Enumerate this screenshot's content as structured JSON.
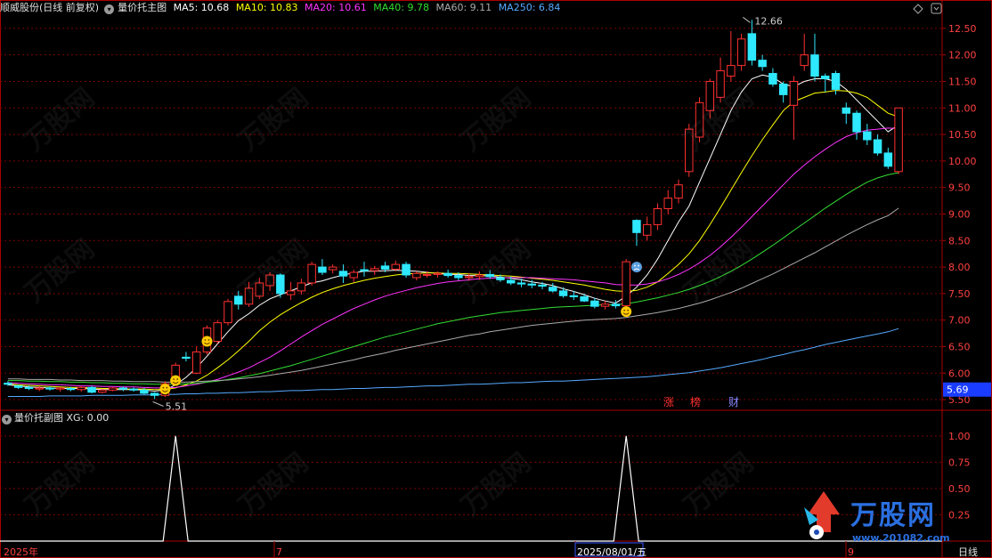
{
  "header": {
    "stock": "顺威股份(日线 前复权)",
    "indicator": "量价托主图",
    "ma": [
      {
        "label": "MA5: 10.68",
        "color": "#ffffff"
      },
      {
        "label": "MA10: 10.83",
        "color": "#ffff00"
      },
      {
        "label": "MA20: 10.61",
        "color": "#ff33ff"
      },
      {
        "label": "MA40: 9.78",
        "color": "#33dd33"
      },
      {
        "label": "MA60: 9.11",
        "color": "#aaaaaa"
      },
      {
        "label": "MA250: 6.84",
        "color": "#55aaff"
      }
    ]
  },
  "sub_header": {
    "title": "量价托副图",
    "xg": "XG: 0.00"
  },
  "colors": {
    "up": "#ff3030",
    "down": "#2ee8ff",
    "grid": "#7a0000",
    "axis": "#aa0000",
    "last_price_bg": "#1a3cff"
  },
  "price_axis": {
    "ticks": [
      "12.50",
      "12.00",
      "11.50",
      "11.00",
      "10.50",
      "10.00",
      "9.50",
      "9.00",
      "8.50",
      "8.00",
      "7.50",
      "7.00",
      "6.50",
      "6.00",
      "5.50"
    ]
  },
  "last_price": "5.69",
  "high_label": "12.66",
  "low_label": "5.51",
  "sub_axis": {
    "ticks": [
      "1.00",
      "0.75",
      "0.50",
      "0.25"
    ]
  },
  "badges": [
    "涨",
    "榜",
    "财"
  ],
  "date_axis": {
    "labels": [
      "2025年",
      "7",
      "2025/08/01/五",
      "9"
    ],
    "period": "日线"
  },
  "watermark": {
    "text": "万股网",
    "url": "www.201082.com"
  },
  "logo": {
    "text": "万股网",
    "url": "www.201082.com"
  },
  "chart_data": {
    "type": "candlestick",
    "candles": [
      [
        5.81,
        5.85,
        5.76,
        5.79
      ],
      [
        5.76,
        5.78,
        5.7,
        5.73
      ],
      [
        5.73,
        5.77,
        5.68,
        5.71
      ],
      [
        5.7,
        5.75,
        5.66,
        5.72
      ],
      [
        5.72,
        5.75,
        5.67,
        5.7
      ],
      [
        5.7,
        5.73,
        5.65,
        5.72
      ],
      [
        5.71,
        5.74,
        5.66,
        5.69
      ],
      [
        5.69,
        5.76,
        5.65,
        5.73
      ],
      [
        5.73,
        5.76,
        5.62,
        5.64
      ],
      [
        5.64,
        5.7,
        5.62,
        5.68
      ],
      [
        5.68,
        5.74,
        5.66,
        5.72
      ],
      [
        5.72,
        5.75,
        5.66,
        5.7
      ],
      [
        5.7,
        5.73,
        5.65,
        5.68
      ],
      [
        5.68,
        5.72,
        5.6,
        5.62
      ],
      [
        5.62,
        5.64,
        5.51,
        5.58
      ],
      [
        5.58,
        5.85,
        5.55,
        5.8
      ],
      [
        5.8,
        6.2,
        5.78,
        6.15
      ],
      [
        6.3,
        6.4,
        6.22,
        6.28
      ],
      [
        6.0,
        6.5,
        5.98,
        6.4
      ],
      [
        6.4,
        6.9,
        6.35,
        6.85
      ],
      [
        6.6,
        7.0,
        6.55,
        6.95
      ],
      [
        6.95,
        7.4,
        6.9,
        7.35
      ],
      [
        7.45,
        7.55,
        7.2,
        7.3
      ],
      [
        7.3,
        7.72,
        7.25,
        7.6
      ],
      [
        7.45,
        7.8,
        7.4,
        7.7
      ],
      [
        7.65,
        7.9,
        7.55,
        7.85
      ],
      [
        7.85,
        7.88,
        7.42,
        7.5
      ],
      [
        7.48,
        7.72,
        7.38,
        7.55
      ],
      [
        7.55,
        7.78,
        7.48,
        7.7
      ],
      [
        7.7,
        8.1,
        7.65,
        8.05
      ],
      [
        8.0,
        8.15,
        7.85,
        7.9
      ],
      [
        7.95,
        8.05,
        7.88,
        8.0
      ],
      [
        7.92,
        8.05,
        7.7,
        7.83
      ],
      [
        7.8,
        7.95,
        7.72,
        7.9
      ],
      [
        7.95,
        8.1,
        7.82,
        7.93
      ],
      [
        7.93,
        8.02,
        7.85,
        7.97
      ],
      [
        8.02,
        8.1,
        7.9,
        7.96
      ],
      [
        7.96,
        8.12,
        7.92,
        8.05
      ],
      [
        8.05,
        8.1,
        7.8,
        7.85
      ],
      [
        7.8,
        7.92,
        7.75,
        7.88
      ],
      [
        7.85,
        7.92,
        7.8,
        7.86
      ],
      [
        7.86,
        7.92,
        7.8,
        7.88
      ],
      [
        7.88,
        7.95,
        7.8,
        7.84
      ],
      [
        7.84,
        7.9,
        7.75,
        7.8
      ],
      [
        7.8,
        7.88,
        7.74,
        7.82
      ],
      [
        7.82,
        7.92,
        7.76,
        7.85
      ],
      [
        7.86,
        7.94,
        7.78,
        7.82
      ],
      [
        7.8,
        7.86,
        7.72,
        7.76
      ],
      [
        7.75,
        7.82,
        7.66,
        7.7
      ],
      [
        7.7,
        7.78,
        7.62,
        7.68
      ],
      [
        7.68,
        7.76,
        7.6,
        7.66
      ],
      [
        7.66,
        7.72,
        7.58,
        7.64
      ],
      [
        7.62,
        7.7,
        7.52,
        7.55
      ],
      [
        7.55,
        7.62,
        7.42,
        7.46
      ],
      [
        7.46,
        7.55,
        7.38,
        7.44
      ],
      [
        7.44,
        7.5,
        7.34,
        7.36
      ],
      [
        7.36,
        7.42,
        7.22,
        7.26
      ],
      [
        7.26,
        7.36,
        7.2,
        7.3
      ],
      [
        7.3,
        7.38,
        7.22,
        7.27
      ],
      [
        7.27,
        8.15,
        7.25,
        8.1
      ],
      [
        8.88,
        8.9,
        8.4,
        8.65
      ],
      [
        8.6,
        8.95,
        8.5,
        8.8
      ],
      [
        8.8,
        9.2,
        8.7,
        9.1
      ],
      [
        9.1,
        9.45,
        9.0,
        9.3
      ],
      [
        9.3,
        9.65,
        9.2,
        9.55
      ],
      [
        9.8,
        10.7,
        9.7,
        10.6
      ],
      [
        10.45,
        11.2,
        10.35,
        11.1
      ],
      [
        10.95,
        11.55,
        10.8,
        11.5
      ],
      [
        11.2,
        11.95,
        11.1,
        11.7
      ],
      [
        11.6,
        12.45,
        11.5,
        11.8
      ],
      [
        11.8,
        12.4,
        11.7,
        12.3
      ],
      [
        12.4,
        12.66,
        11.8,
        11.9
      ],
      [
        11.9,
        12.0,
        11.7,
        11.78
      ],
      [
        11.65,
        11.75,
        11.4,
        11.45
      ],
      [
        11.45,
        11.5,
        11.1,
        11.25
      ],
      [
        11.05,
        11.6,
        10.4,
        11.5
      ],
      [
        11.8,
        12.4,
        11.7,
        12.0
      ],
      [
        12.0,
        12.4,
        11.5,
        11.6
      ],
      [
        11.6,
        11.65,
        11.3,
        11.55
      ],
      [
        11.65,
        11.7,
        11.25,
        11.35
      ],
      [
        11.0,
        11.1,
        10.7,
        10.9
      ],
      [
        10.9,
        10.95,
        10.4,
        10.55
      ],
      [
        10.55,
        10.7,
        10.3,
        10.4
      ],
      [
        10.4,
        10.5,
        10.1,
        10.15
      ],
      [
        10.15,
        10.25,
        9.85,
        9.9
      ],
      [
        9.8,
        11.0,
        9.75,
        11.0
      ]
    ],
    "ma": [
      {
        "name": "MA5",
        "color": "#ffffff",
        "values": [
          5.78,
          5.76,
          5.74,
          5.73,
          5.72,
          5.71,
          5.71,
          5.71,
          5.7,
          5.69,
          5.69,
          5.69,
          5.69,
          5.68,
          5.66,
          5.68,
          5.78,
          5.92,
          6.1,
          6.32,
          6.55,
          6.78,
          6.99,
          7.12,
          7.28,
          7.4,
          7.48,
          7.55,
          7.63,
          7.7,
          7.74,
          7.8,
          7.85,
          7.89,
          7.92,
          7.92,
          7.93,
          7.94,
          7.93,
          7.92,
          7.9,
          7.88,
          7.86,
          7.86,
          7.84,
          7.84,
          7.83,
          7.81,
          7.79,
          7.76,
          7.72,
          7.69,
          7.65,
          7.59,
          7.54,
          7.48,
          7.41,
          7.36,
          7.32,
          7.45,
          7.62,
          7.85,
          8.15,
          8.5,
          8.85,
          9.15,
          9.6,
          10.05,
          10.5,
          10.95,
          11.3,
          11.55,
          11.62,
          11.58,
          11.45,
          11.4,
          11.5,
          11.55,
          11.55,
          11.5,
          11.35,
          11.15,
          10.95,
          10.75,
          10.55,
          10.68
        ]
      },
      {
        "name": "MA10",
        "color": "#ffff00",
        "values": [
          5.8,
          5.78,
          5.77,
          5.76,
          5.75,
          5.74,
          5.73,
          5.73,
          5.72,
          5.71,
          5.71,
          5.7,
          5.7,
          5.7,
          5.69,
          5.69,
          5.72,
          5.78,
          5.85,
          5.96,
          6.1,
          6.25,
          6.42,
          6.6,
          6.8,
          6.96,
          7.1,
          7.22,
          7.33,
          7.43,
          7.52,
          7.59,
          7.65,
          7.7,
          7.75,
          7.79,
          7.82,
          7.85,
          7.87,
          7.88,
          7.89,
          7.89,
          7.88,
          7.88,
          7.87,
          7.86,
          7.85,
          7.84,
          7.83,
          7.81,
          7.79,
          7.77,
          7.75,
          7.72,
          7.69,
          7.66,
          7.62,
          7.58,
          7.55,
          7.54,
          7.56,
          7.62,
          7.72,
          7.88,
          8.05,
          8.25,
          8.5,
          8.8,
          9.12,
          9.45,
          9.78,
          10.1,
          10.4,
          10.68,
          10.95,
          11.12,
          11.2,
          11.28,
          11.3,
          11.33,
          11.32,
          11.28,
          11.2,
          11.05,
          10.9,
          10.83
        ]
      },
      {
        "name": "MA20",
        "color": "#ff33ff",
        "values": [
          5.82,
          5.81,
          5.8,
          5.79,
          5.78,
          5.78,
          5.77,
          5.76,
          5.76,
          5.75,
          5.75,
          5.74,
          5.74,
          5.73,
          5.72,
          5.72,
          5.73,
          5.76,
          5.79,
          5.83,
          5.88,
          5.95,
          6.02,
          6.1,
          6.2,
          6.3,
          6.42,
          6.55,
          6.68,
          6.8,
          6.92,
          7.02,
          7.12,
          7.22,
          7.3,
          7.38,
          7.45,
          7.51,
          7.56,
          7.61,
          7.65,
          7.69,
          7.72,
          7.74,
          7.76,
          7.78,
          7.79,
          7.8,
          7.8,
          7.8,
          7.8,
          7.79,
          7.78,
          7.77,
          7.76,
          7.74,
          7.72,
          7.7,
          7.67,
          7.66,
          7.66,
          7.68,
          7.72,
          7.78,
          7.86,
          7.96,
          8.08,
          8.22,
          8.38,
          8.56,
          8.75,
          8.95,
          9.15,
          9.35,
          9.55,
          9.75,
          9.92,
          10.08,
          10.22,
          10.35,
          10.46,
          10.53,
          10.58,
          10.6,
          10.62,
          10.61
        ]
      },
      {
        "name": "MA40",
        "color": "#33dd33",
        "values": [
          5.86,
          5.86,
          5.85,
          5.85,
          5.84,
          5.84,
          5.83,
          5.83,
          5.82,
          5.82,
          5.81,
          5.81,
          5.8,
          5.8,
          5.79,
          5.79,
          5.79,
          5.8,
          5.81,
          5.83,
          5.85,
          5.88,
          5.91,
          5.95,
          5.99,
          6.04,
          6.09,
          6.14,
          6.2,
          6.26,
          6.32,
          6.38,
          6.44,
          6.5,
          6.56,
          6.62,
          6.68,
          6.73,
          6.78,
          6.83,
          6.88,
          6.93,
          6.97,
          7.01,
          7.05,
          7.08,
          7.11,
          7.14,
          7.16,
          7.18,
          7.2,
          7.22,
          7.24,
          7.25,
          7.26,
          7.27,
          7.28,
          7.29,
          7.29,
          7.31,
          7.34,
          7.38,
          7.42,
          7.47,
          7.52,
          7.58,
          7.65,
          7.73,
          7.82,
          7.92,
          8.03,
          8.15,
          8.28,
          8.41,
          8.55,
          8.69,
          8.83,
          8.97,
          9.11,
          9.24,
          9.37,
          9.49,
          9.6,
          9.68,
          9.74,
          9.78
        ]
      },
      {
        "name": "MA60",
        "color": "#aaaaaa",
        "values": [
          5.89,
          5.89,
          5.88,
          5.88,
          5.88,
          5.87,
          5.87,
          5.86,
          5.86,
          5.86,
          5.85,
          5.85,
          5.84,
          5.84,
          5.84,
          5.83,
          5.83,
          5.83,
          5.84,
          5.85,
          5.86,
          5.87,
          5.89,
          5.91,
          5.93,
          5.96,
          5.99,
          6.02,
          6.05,
          6.09,
          6.13,
          6.17,
          6.21,
          6.25,
          6.3,
          6.34,
          6.38,
          6.43,
          6.47,
          6.51,
          6.55,
          6.59,
          6.63,
          6.67,
          6.71,
          6.74,
          6.78,
          6.81,
          6.84,
          6.87,
          6.9,
          6.92,
          6.94,
          6.96,
          6.98,
          7.0,
          7.01,
          7.02,
          7.03,
          7.05,
          7.08,
          7.11,
          7.14,
          7.18,
          7.22,
          7.27,
          7.32,
          7.38,
          7.45,
          7.52,
          7.6,
          7.69,
          7.78,
          7.87,
          7.97,
          8.07,
          8.17,
          8.27,
          8.38,
          8.49,
          8.6,
          8.7,
          8.8,
          8.89,
          8.97,
          9.11
        ]
      },
      {
        "name": "MA250",
        "color": "#55aaff",
        "values": [
          5.56,
          5.56,
          5.56,
          5.56,
          5.57,
          5.57,
          5.57,
          5.57,
          5.58,
          5.58,
          5.58,
          5.58,
          5.59,
          5.59,
          5.59,
          5.6,
          5.6,
          5.61,
          5.61,
          5.62,
          5.62,
          5.63,
          5.63,
          5.64,
          5.65,
          5.65,
          5.66,
          5.67,
          5.67,
          5.68,
          5.69,
          5.69,
          5.7,
          5.71,
          5.71,
          5.72,
          5.73,
          5.73,
          5.74,
          5.75,
          5.76,
          5.76,
          5.77,
          5.78,
          5.79,
          5.79,
          5.8,
          5.81,
          5.82,
          5.82,
          5.83,
          5.84,
          5.85,
          5.85,
          5.86,
          5.87,
          5.88,
          5.89,
          5.9,
          5.91,
          5.92,
          5.93,
          5.95,
          5.97,
          5.99,
          6.01,
          6.04,
          6.07,
          6.1,
          6.14,
          6.18,
          6.22,
          6.26,
          6.31,
          6.35,
          6.4,
          6.44,
          6.49,
          6.54,
          6.58,
          6.62,
          6.66,
          6.7,
          6.74,
          6.78,
          6.84
        ]
      }
    ],
    "signals": [
      {
        "index": 15,
        "type": "smile",
        "price": 5.7
      },
      {
        "index": 16,
        "type": "smile",
        "price": 5.86
      },
      {
        "index": 19,
        "type": "smile",
        "price": 6.6
      },
      {
        "index": 59,
        "type": "smile",
        "price": 7.16
      },
      {
        "index": 60,
        "type": "sad",
        "price": 8.0
      }
    ],
    "sub_series": {
      "name": "XG",
      "spike_indices": [
        16,
        59
      ],
      "ylim": [
        0,
        1.1
      ]
    },
    "ylim": [
      5.35,
      12.8
    ]
  }
}
